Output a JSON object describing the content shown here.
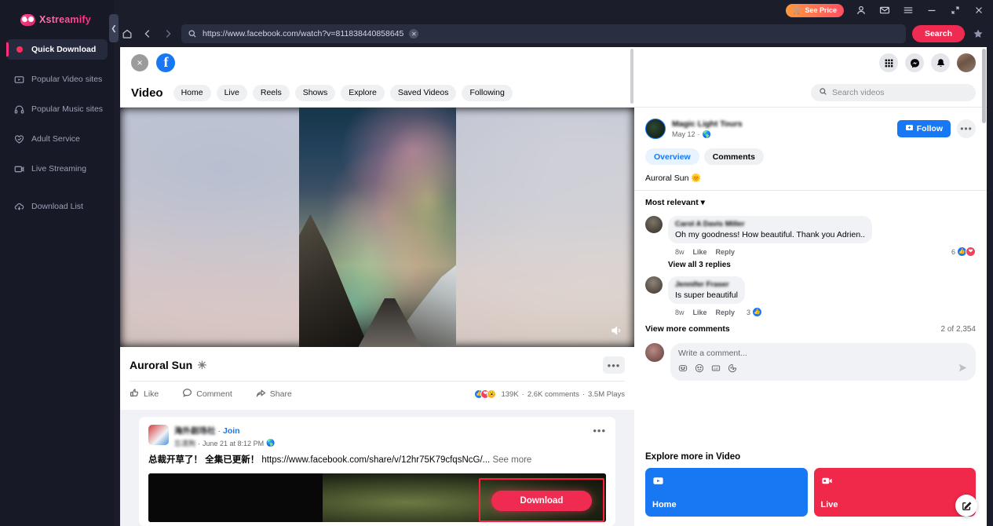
{
  "app": {
    "brand_name": "Xstreamify",
    "see_price": "See Price",
    "titlebar_icons": [
      "account-icon",
      "mail-icon",
      "menu-icon",
      "minimize-icon",
      "restore-icon",
      "close-icon"
    ]
  },
  "sidebar": {
    "items": [
      {
        "label": "Quick Download",
        "icon": "red-dot-icon",
        "active": true
      },
      {
        "label": "Popular Video sites",
        "icon": "video-box-icon",
        "active": false
      },
      {
        "label": "Popular Music sites",
        "icon": "headphones-icon",
        "active": false
      },
      {
        "label": "Adult Service",
        "icon": "heart-shield-icon",
        "active": false
      },
      {
        "label": "Live Streaming",
        "icon": "live-box-icon",
        "active": false
      },
      {
        "label": "Download List",
        "icon": "cloud-download-icon",
        "active": false
      }
    ]
  },
  "addressbar": {
    "url": "https://www.facebook.com/watch?v=811838440858645",
    "search_button": "Search",
    "home_icon": "home-icon",
    "back_icon": "back-arrow-icon",
    "forward_icon": "forward-arrow-icon",
    "clear_icon": "clear-icon",
    "star_icon": "star-icon"
  },
  "facebook": {
    "topbar": {
      "close_label": "×",
      "logo": "facebook-logo",
      "icons": [
        "grid-apps-icon",
        "messenger-icon",
        "notifications-bell-icon",
        "profile-avatar"
      ]
    },
    "nav": {
      "title": "Video",
      "pills": [
        "Home",
        "Live",
        "Reels",
        "Shows",
        "Explore",
        "Saved Videos",
        "Following"
      ],
      "search_placeholder": "Search videos"
    },
    "video": {
      "title": "Auroral Sun",
      "title_emoji": "☀",
      "actions": [
        "Like",
        "Comment",
        "Share"
      ],
      "reactions_count": "139K",
      "comments_count": "2.6K comments",
      "plays_count": "3.5M Plays",
      "stat_separator": "·",
      "more_label": "•••",
      "volume_icon": "volume-icon"
    },
    "author": {
      "name": "Magic Light Tours",
      "date": "May 12",
      "privacy_icon": "globe-icon",
      "follow_label": "Follow",
      "more_label": "•••"
    },
    "detail_tabs": [
      {
        "label": "Overview",
        "selected": true
      },
      {
        "label": "Comments",
        "selected": false
      }
    ],
    "description": "Auroral Sun 🌞",
    "comments": {
      "sort_label": "Most relevant",
      "sort_caret": "▾",
      "items": [
        {
          "name": "Carol A Davis Miller",
          "text": "Oh my goodness! How beautiful. Thank you Adrien..",
          "time": "8w",
          "like": "Like",
          "reply": "Reply",
          "reaction_count": "6",
          "reactions": [
            "like",
            "love"
          ],
          "replies_label": "View all 3 replies"
        },
        {
          "name": "Jennifer Fraser",
          "text": "Is super beautiful",
          "time": "8w",
          "like": "Like",
          "reply": "Reply",
          "reaction_count": "3",
          "reactions": [
            "like"
          ],
          "replies_label": ""
        }
      ],
      "view_more": "View more comments",
      "count_label": "2 of 2,354"
    },
    "comment_box": {
      "placeholder": "Write a comment...",
      "icons": [
        "avatar-sticker-icon",
        "emoji-icon",
        "gif-icon",
        "sticker-icon"
      ],
      "send_icon": "send-icon"
    },
    "explore": {
      "title": "Explore more in Video",
      "cards": [
        {
          "label": "Home",
          "color": "#1877f2",
          "icon": "video-home-icon"
        },
        {
          "label": "Live",
          "color": "#f02849",
          "icon": "live-camera-icon"
        }
      ]
    },
    "second_post": {
      "page_name": "海外剧场社",
      "join_label": "Join",
      "poster_name": "忘清狗",
      "date": "June 21 at 8:12 PM",
      "separator": "·",
      "text_bold": "总裁开草了！ 全集已更新！",
      "text_link": "https://www.facebook.com/share/v/12hr75K79cfqsNcG/...",
      "see_more": "See more",
      "more_label": "•••"
    },
    "download_button": "Download",
    "compose_icon": "compose-edit-icon"
  },
  "colors": {
    "brand_pink": "#ff2f7d",
    "action_red": "#ef2b52",
    "fb_blue": "#1877f2",
    "live_red": "#f02849",
    "annotation_red": "#ff1f3d"
  }
}
